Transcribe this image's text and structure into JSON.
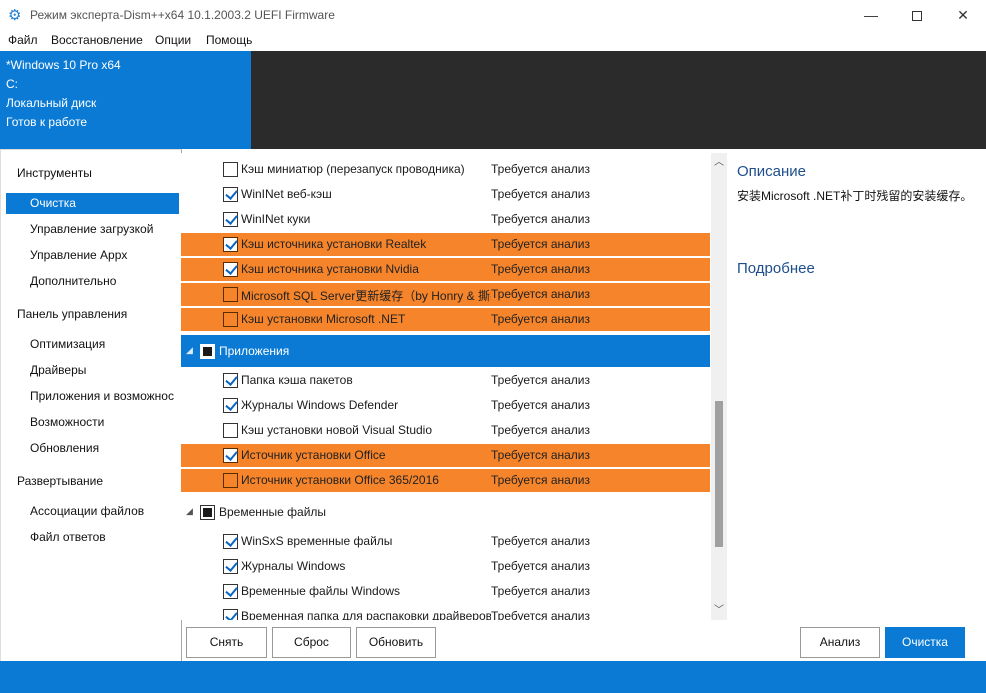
{
  "window": {
    "title": "Режим эксперта-Dism++x64 10.1.2003.2 UEFI Firmware",
    "minimize": "—",
    "close": "✕"
  },
  "menu": [
    "Файл",
    "Восстановление",
    "Опции",
    "Помощь"
  ],
  "header": {
    "lines": [
      "*Windows 10 Pro x64",
      "C:",
      "Локальный диск",
      "Готов к работе"
    ]
  },
  "sidebar": {
    "groups": [
      {
        "label": "Инструменты",
        "items": [
          "Очистка",
          "Управление загрузкой",
          "Управление Appx",
          "Дополнительно"
        ]
      },
      {
        "label": "Панель управления",
        "items": [
          "Оптимизация",
          "Драйверы",
          "Приложения и возможнос",
          "Возможности",
          "Обновления"
        ]
      },
      {
        "label": "Развертывание",
        "items": [
          "Ассоциации файлов",
          "Файл ответов"
        ]
      }
    ],
    "active_item": "Очистка"
  },
  "list": {
    "status_text": "Требуется анализ",
    "rows_top": [
      {
        "label": "Кэш миниатюр (перезапуск проводника)",
        "checked": false,
        "highlight": false
      },
      {
        "label": "WinINet веб-кэш",
        "checked": true,
        "highlight": false
      },
      {
        "label": "WinINet куки",
        "checked": true,
        "highlight": false
      },
      {
        "label": "Кэш источника установки Realtek",
        "checked": true,
        "highlight": true
      },
      {
        "label": "Кэш источника установки Nvidia",
        "checked": true,
        "highlight": true
      },
      {
        "label": "Microsoft SQL Server更新缓存（by Honry & 撕裂",
        "checked": false,
        "highlight": true
      },
      {
        "label": "Кэш установки Microsoft .NET",
        "checked": false,
        "highlight": true
      }
    ],
    "group_apps": {
      "label": "Приложения",
      "arrow": "◢"
    },
    "rows_apps": [
      {
        "label": "Папка кэша пакетов",
        "checked": true,
        "highlight": false
      },
      {
        "label": "Журналы Windows Defender",
        "checked": true,
        "highlight": false
      },
      {
        "label": "Кэш установки новой Visual Studio",
        "checked": false,
        "highlight": false
      },
      {
        "label": "Источник установки Office",
        "checked": true,
        "highlight": true
      },
      {
        "label": "Источник установки Office 365/2016",
        "checked": false,
        "highlight": true
      }
    ],
    "group_temp": {
      "label": "Временные файлы",
      "arrow": "◢"
    },
    "rows_temp": [
      {
        "label": "WinSxS временные файлы",
        "checked": true,
        "highlight": false
      },
      {
        "label": "Журналы Windows",
        "checked": true,
        "highlight": false
      },
      {
        "label": "Временные файлы Windows",
        "checked": true,
        "highlight": false
      },
      {
        "label": "Временная папка для распаковки драйверов",
        "checked": true,
        "highlight": false
      }
    ]
  },
  "description": {
    "title": "Описание",
    "text": "安装Microsoft .NET补丁时残留的安装缓存。",
    "more": "Подробнее"
  },
  "buttons": {
    "remove": "Снять",
    "reset": "Сброс",
    "refresh": "Обновить",
    "analyze": "Анализ",
    "clean": "Очистка"
  },
  "colors": {
    "accent": "#0a7ad4",
    "highlight": "#f6842a",
    "header_dark": "#2b2b2b"
  }
}
